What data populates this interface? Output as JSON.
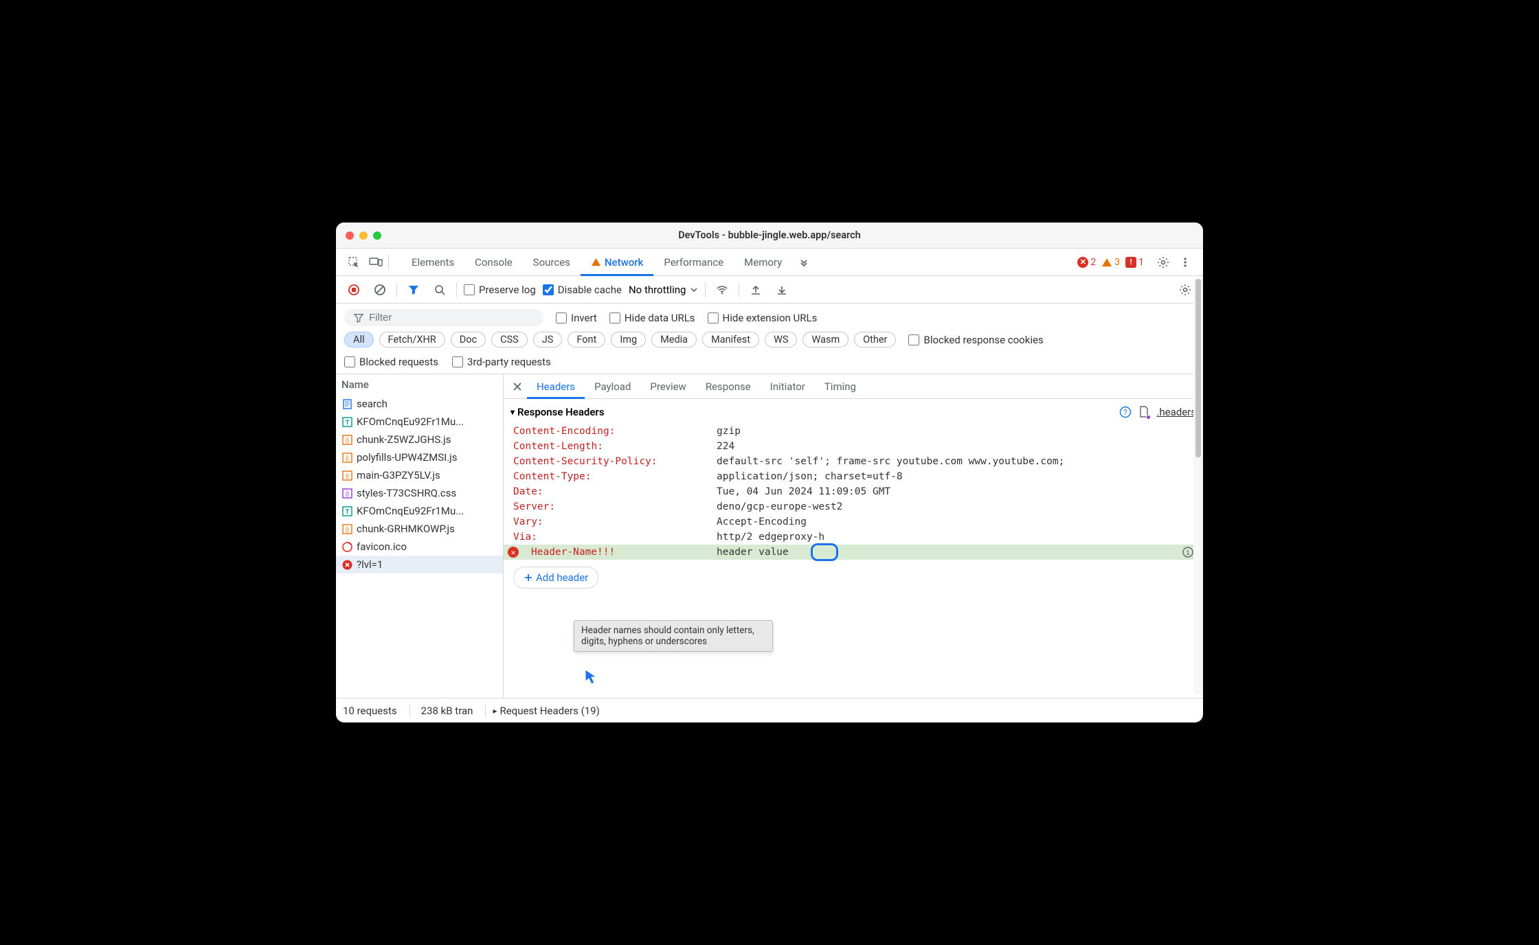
{
  "window": {
    "title": "DevTools - bubble-jingle.web.app/search"
  },
  "main_tabs": [
    "Elements",
    "Console",
    "Sources",
    "Network",
    "Performance",
    "Memory"
  ],
  "main_tab_active": "Network",
  "status": {
    "errors": "2",
    "warnings": "3",
    "issues": "1"
  },
  "toolbar": {
    "preserve_log": "Preserve log",
    "disable_cache": "Disable cache",
    "throttling": "No throttling"
  },
  "filter": {
    "placeholder": "Filter",
    "invert": "Invert",
    "hide_data": "Hide data URLs",
    "hide_ext": "Hide extension URLs"
  },
  "type_pills": [
    "All",
    "Fetch/XHR",
    "Doc",
    "CSS",
    "JS",
    "Font",
    "Img",
    "Media",
    "Manifest",
    "WS",
    "Wasm",
    "Other"
  ],
  "type_pill_active": "All",
  "blocked_cookies": "Blocked response cookies",
  "blocked_req": "Blocked requests",
  "third_party": "3rd-party requests",
  "left": {
    "header": "Name",
    "items": [
      {
        "type": "doc",
        "name": "search"
      },
      {
        "type": "font",
        "name": "KFOmCnqEu92Fr1Mu..."
      },
      {
        "type": "js",
        "name": "chunk-Z5WZJGHS.js"
      },
      {
        "type": "js",
        "name": "polyfills-UPW4ZMSI.js"
      },
      {
        "type": "js",
        "name": "main-G3PZY5LV.js"
      },
      {
        "type": "css",
        "name": "styles-T73CSHRQ.css"
      },
      {
        "type": "font",
        "name": "KFOmCnqEu92Fr1Mu..."
      },
      {
        "type": "js",
        "name": "chunk-GRHMKOWP.js"
      },
      {
        "type": "ico",
        "name": "favicon.ico"
      },
      {
        "type": "err",
        "name": "?lvl=1"
      }
    ],
    "selected": 9
  },
  "detail_tabs": [
    "Headers",
    "Payload",
    "Preview",
    "Response",
    "Initiator",
    "Timing"
  ],
  "detail_tab_active": "Headers",
  "response_headers": {
    "title": "Response Headers",
    "headers_link": ".headers",
    "rows": [
      {
        "name": "Content-Encoding:",
        "value": "gzip"
      },
      {
        "name": "Content-Length:",
        "value": "224"
      },
      {
        "name": "Content-Security-Policy:",
        "value": "default-src 'self'; frame-src youtube.com www.youtube.com;"
      },
      {
        "name": "Content-Type:",
        "value": "application/json; charset=utf-8"
      },
      {
        "name": "Date:",
        "value": "Tue, 04 Jun 2024 11:09:05 GMT"
      },
      {
        "name": "Server:",
        "value": "deno/gcp-europe-west2"
      },
      {
        "name": "Vary:",
        "value": "Accept-Encoding"
      },
      {
        "name": "Via:",
        "value": "http/2 edgeproxy-h"
      }
    ],
    "override": {
      "name": "Header-Name!!!",
      "value": "header value"
    },
    "add_label": "Add header"
  },
  "tooltip": "Header names should contain only letters, digits, hyphens or underscores",
  "footer": {
    "requests": "10 requests",
    "transferred": "238 kB tran",
    "request_headers": "Request Headers (19)"
  }
}
